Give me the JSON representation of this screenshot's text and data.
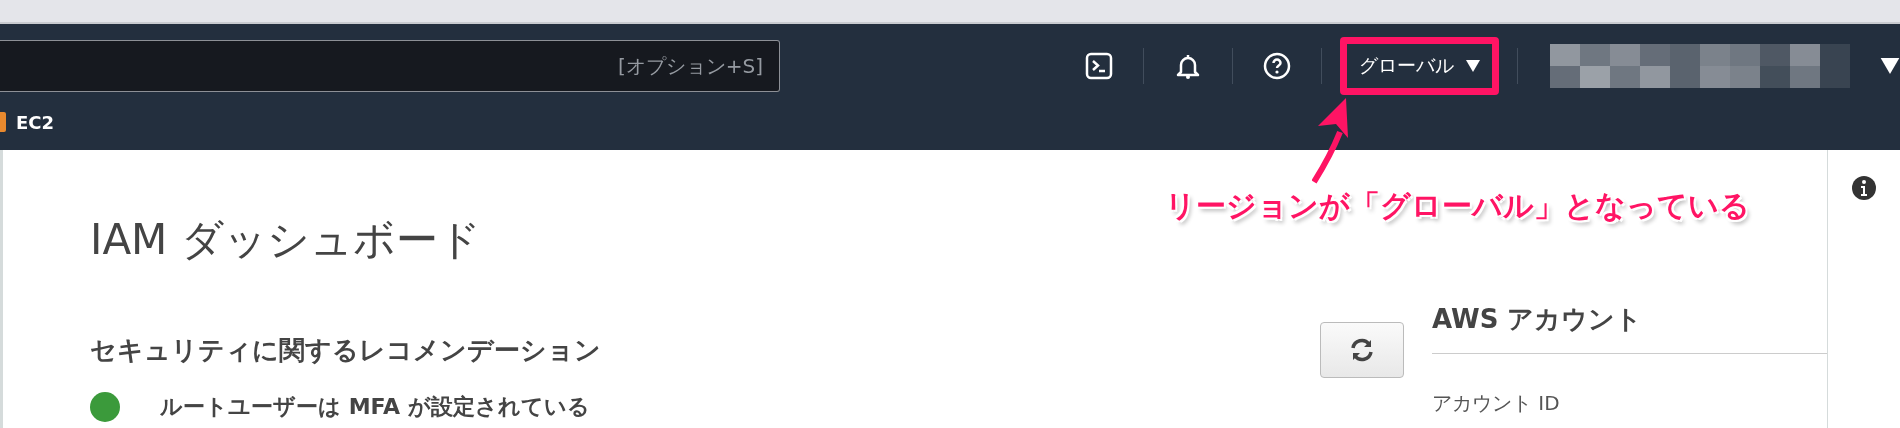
{
  "search": {
    "placeholder": "[オプション+S]"
  },
  "region_menu": {
    "label": "グローバル"
  },
  "favorites": [
    {
      "label": "EC2"
    }
  ],
  "page": {
    "title": "IAM ダッシュボード",
    "section_title": "セキュリティに関するレコメンデーション",
    "recommendations": [
      {
        "text": "ルートユーザーは MFA が設定されている",
        "checked": true
      }
    ]
  },
  "account_panel": {
    "title": "AWS アカウント",
    "fields": [
      {
        "label": "アカウント ID"
      }
    ]
  },
  "annotation": {
    "text": "リージョンが「グローバル」となっている"
  }
}
